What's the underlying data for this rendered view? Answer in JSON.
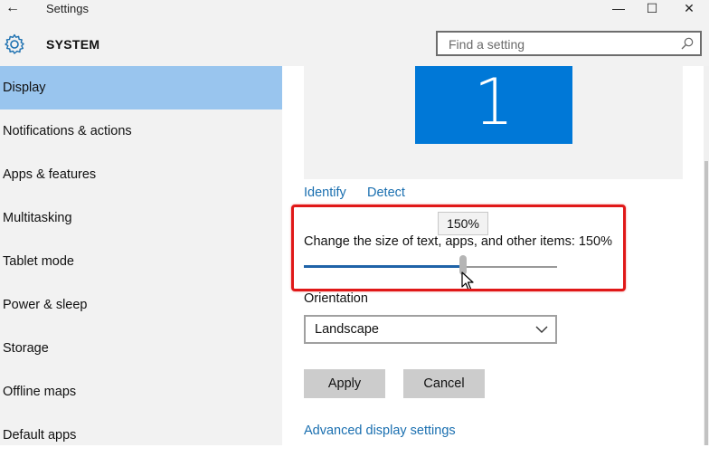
{
  "window": {
    "title": "Settings",
    "back_glyph": "←",
    "minimize_glyph": "—",
    "maximize_glyph": "☐",
    "close_glyph": "✕"
  },
  "header": {
    "section_title": "SYSTEM",
    "search_placeholder": "Find a setting"
  },
  "sidebar": {
    "items": [
      {
        "label": "Display",
        "active": true
      },
      {
        "label": "Notifications & actions"
      },
      {
        "label": "Apps & features"
      },
      {
        "label": "Multitasking"
      },
      {
        "label": "Tablet mode"
      },
      {
        "label": "Power & sleep"
      },
      {
        "label": "Storage"
      },
      {
        "label": "Offline maps"
      },
      {
        "label": "Default apps"
      }
    ]
  },
  "display": {
    "monitor_number": "1",
    "identify_link": "Identify",
    "detect_link": "Detect",
    "scale_tooltip": "150%",
    "scale_label": "Change the size of text, apps, and other items: 150%",
    "scale_slider_fraction": 0.63,
    "orientation_label": "Orientation",
    "orientation_value": "Landscape",
    "apply_button": "Apply",
    "cancel_button": "Cancel",
    "advanced_link": "Advanced display settings"
  },
  "colors": {
    "accent": "#0078d7",
    "active_nav": "#99c5ee",
    "link": "#1a6fb0",
    "highlight": "#e01818"
  }
}
